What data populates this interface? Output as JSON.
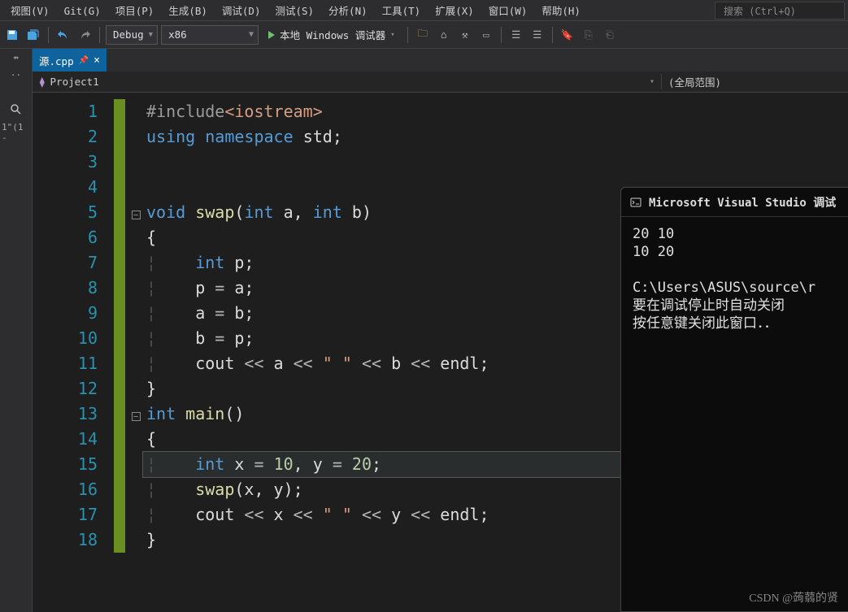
{
  "menu": {
    "items": [
      "视图(V)",
      "Git(G)",
      "项目(P)",
      "生成(B)",
      "调试(D)",
      "测试(S)",
      "分析(N)",
      "工具(T)",
      "扩展(X)",
      "窗口(W)",
      "帮助(H)"
    ]
  },
  "search": {
    "placeholder": "搜索 (Ctrl+Q)"
  },
  "toolbar": {
    "config": "Debug",
    "platform": "x86",
    "start": "本地 Windows 调试器"
  },
  "left": {
    "pin": "⇴",
    "dots": "..",
    "search": "🔎",
    "txt": "1\"(1 -"
  },
  "tab": {
    "name": "源.cpp",
    "pin": "📌",
    "close": "×"
  },
  "nav": {
    "project_icon": "⧉",
    "project": "Project1",
    "scope": "(全局范围)"
  },
  "code": {
    "lines": [
      {
        "n": 1,
        "fold": "",
        "html": "<span class='k-inc'>#include</span><span class='k-str'>&lt;iostream&gt;</span>"
      },
      {
        "n": 2,
        "fold": "",
        "html": "<span class='k-blue'>using</span> <span class='k-blue'>namespace</span> <span class='k-id'>std</span>;"
      },
      {
        "n": 3,
        "fold": "",
        "html": ""
      },
      {
        "n": 4,
        "fold": "",
        "html": ""
      },
      {
        "n": 5,
        "fold": "[-]",
        "html": "<span class='k-blue'>void</span> <span class='k-func'>swap</span>(<span class='k-blue'>int</span> a, <span class='k-blue'>int</span> b)"
      },
      {
        "n": 6,
        "fold": "",
        "html": "{",
        "guide": ""
      },
      {
        "n": 7,
        "fold": "",
        "html": "    <span class='k-blue'>int</span> p;",
        "guide": "|"
      },
      {
        "n": 8,
        "fold": "",
        "html": "    p <span class='k-op'>=</span> a;",
        "guide": "|"
      },
      {
        "n": 9,
        "fold": "",
        "html": "    a <span class='k-op'>=</span> b;",
        "guide": "|"
      },
      {
        "n": 10,
        "fold": "",
        "html": "    b <span class='k-op'>=</span> p;",
        "guide": "|"
      },
      {
        "n": 11,
        "fold": "",
        "html": "    cout <span class='k-op'>&lt;&lt;</span> a <span class='k-op'>&lt;&lt;</span> <span class='k-str'>\" \"</span> <span class='k-op'>&lt;&lt;</span> b <span class='k-op'>&lt;&lt;</span> endl;",
        "guide": "|"
      },
      {
        "n": 12,
        "fold": "",
        "html": "}",
        "guide": ""
      },
      {
        "n": 13,
        "fold": "[-]",
        "html": "<span class='k-blue'>int</span> <span class='k-func'>main</span>()"
      },
      {
        "n": 14,
        "fold": "",
        "html": "{",
        "guide": ""
      },
      {
        "n": 15,
        "fold": "",
        "html": "    <span class='k-blue'>int</span> x <span class='k-op'>=</span> <span class='k-num'>10</span>, y <span class='k-op'>=</span> <span class='k-num'>20</span>;",
        "guide": "|",
        "hl": true
      },
      {
        "n": 16,
        "fold": "",
        "html": "    <span class='k-func'>swap</span>(x, y);",
        "guide": "|"
      },
      {
        "n": 17,
        "fold": "",
        "html": "    cout <span class='k-op'>&lt;&lt;</span> x <span class='k-op'>&lt;&lt;</span> <span class='k-str'>\" \"</span> <span class='k-op'>&lt;&lt;</span> y <span class='k-op'>&lt;&lt;</span> endl;",
        "guide": "|"
      },
      {
        "n": 18,
        "fold": "",
        "html": "}",
        "guide": ""
      }
    ]
  },
  "console": {
    "title": "Microsoft Visual Studio 调试",
    "out": "20 10\n10 20\n\nC:\\Users\\ASUS\\source\\r\n要在调试停止时自动关闭\n按任意键关闭此窗口．．\n"
  },
  "watermark": "CSDN @蒟蒻的贤"
}
